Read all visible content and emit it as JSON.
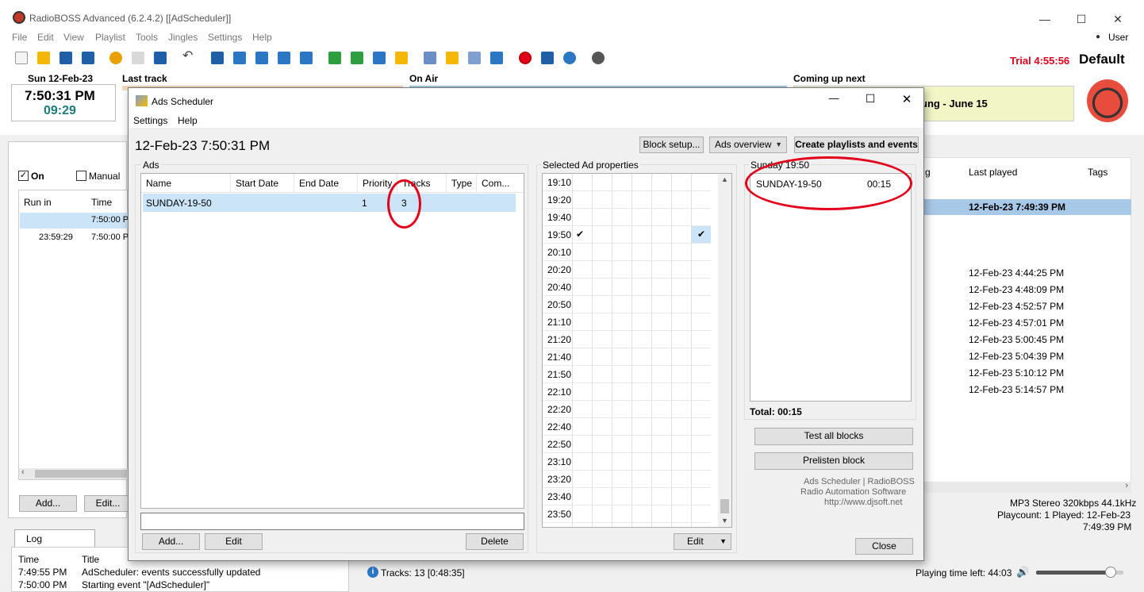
{
  "app": {
    "title": "RadioBOSS Advanced (6.2.4.2) [[AdScheduler]]",
    "user_label": "User",
    "trial_label": "Trial 4:55:56",
    "profile": "Default"
  },
  "menu": [
    "File",
    "Edit",
    "View",
    "Playlist",
    "Tools",
    "Jingles",
    "Settings",
    "Help"
  ],
  "info": {
    "date": "Sun 12-Feb-23",
    "clock": "7:50:31 PM",
    "sub_clock": "09:29",
    "last_track": "Last track",
    "on_air": "On Air",
    "coming_next": "Coming up next",
    "next_title": "ung - June 15"
  },
  "left": {
    "on_label": "On",
    "manual_label": "Manual",
    "col_run_in": "Run in",
    "col_time": "Time",
    "rows": [
      {
        "run_in": "",
        "time": "7:50:00 P"
      },
      {
        "run_in": "23:59:29",
        "time": "7:50:00 P"
      }
    ],
    "add_btn": "Add...",
    "edit_btn": "Edit..."
  },
  "right": {
    "col_g": "g",
    "col_last_played": "Last played",
    "col_tags": "Tags",
    "selected_last": "12-Feb-23 7:49:39 PM",
    "history": [
      "12-Feb-23 4:44:25 PM",
      "12-Feb-23 4:48:09 PM",
      "12-Feb-23 4:52:57 PM",
      "12-Feb-23 4:57:01 PM",
      "12-Feb-23 5:00:45 PM",
      "12-Feb-23 5:04:39 PM",
      "12-Feb-23 5:10:12 PM",
      "12-Feb-23 5:14:57 PM"
    ],
    "format": "MP3 Stereo 320kbps 44.1kHz",
    "playcount": "Playcount: 1  Played: 12-Feb-23",
    "played_time": "7:49:39 PM"
  },
  "log": {
    "tab": "Log",
    "col_time": "Time",
    "col_title": "Title",
    "rows": [
      {
        "time": "7:49:55 PM",
        "title": "AdScheduler: events successfully updated"
      },
      {
        "time": "7:50:00 PM",
        "title": "Starting event \"[AdScheduler]\""
      }
    ]
  },
  "status": {
    "tracks": "Tracks: 13 [0:48:35]",
    "playing_left": "Playing time left: 44:03",
    "volume": 0.85
  },
  "dialog": {
    "title": "Ads Scheduler",
    "menu": [
      "Settings",
      "Help"
    ],
    "timestamp": "12-Feb-23 7:50:31 PM",
    "block_setup": "Block setup...",
    "ads_overview": "Ads overview",
    "create_btn": "Create playlists and events",
    "ads_group": "Ads",
    "ads_columns": [
      "Name",
      "Start Date",
      "End Date",
      "Priority",
      "Tracks",
      "Type",
      "Com..."
    ],
    "ads_rows": [
      {
        "name": "SUNDAY-19-50",
        "start": "",
        "end": "",
        "priority": "1",
        "tracks": "3",
        "type": "",
        "comment": ""
      }
    ],
    "ads_add": "Add...",
    "ads_edit": "Edit",
    "ads_delete": "Delete",
    "props_group": "Selected Ad properties",
    "times": [
      "19:10",
      "19:20",
      "19:40",
      "19:50",
      "20:10",
      "20:20",
      "20:40",
      "20:50",
      "21:10",
      "21:20",
      "21:40",
      "21:50",
      "22:10",
      "22:20",
      "22:40",
      "22:50",
      "23:10",
      "23:20",
      "23:40",
      "23:50"
    ],
    "props_edit": "Edit",
    "block_group": "Sunday 19:50",
    "block_items": [
      {
        "name": "SUNDAY-19-50",
        "duration": "00:15"
      }
    ],
    "total": "Total: 00:15",
    "test_all": "Test all blocks",
    "prelisten": "Prelisten block",
    "footer1": "Ads Scheduler | RadioBOSS",
    "footer2": "Radio Automation Software",
    "footer3": "http://www.djsoft.net",
    "close": "Close"
  },
  "colors": {
    "highlight": "#cce4f7",
    "selected_right": "#a8c8e8",
    "annotation": "#e3001b",
    "trial": "#e3001b",
    "clock_sub": "#1e7b7b"
  }
}
